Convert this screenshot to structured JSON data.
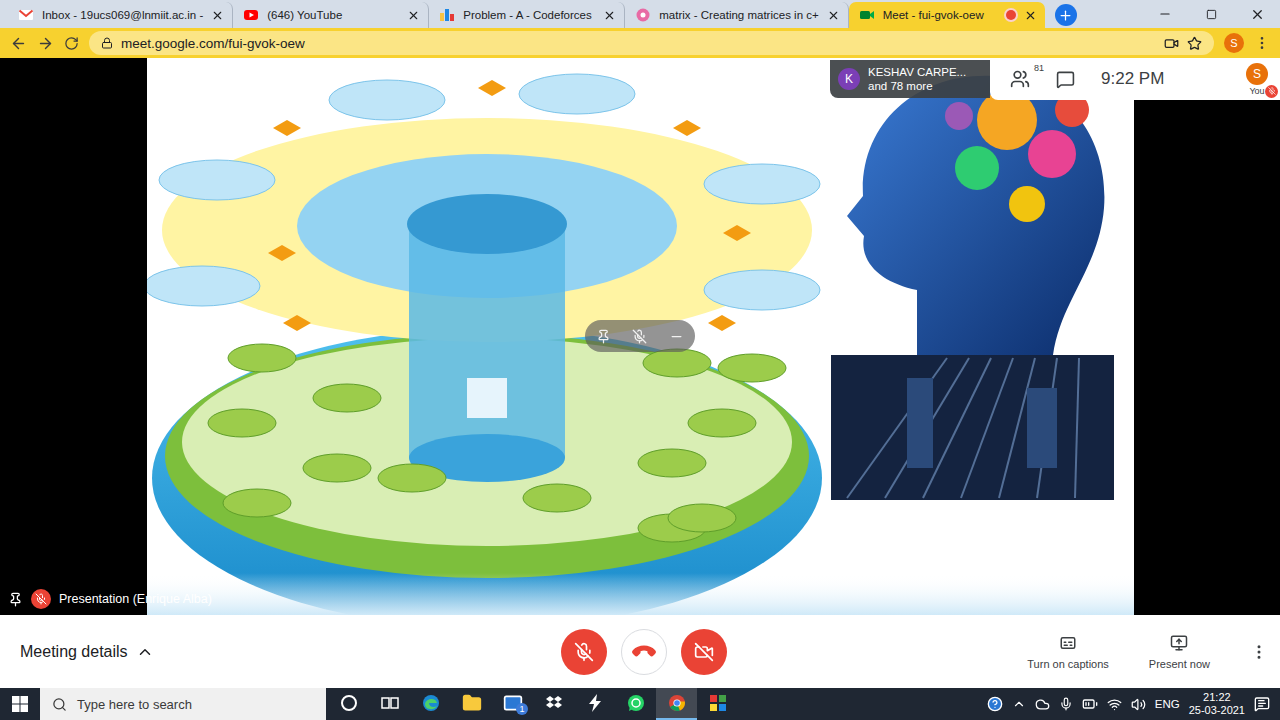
{
  "browser": {
    "tabs": [
      {
        "label": "Inbox - 19ucs069@lnmiit.ac.in -",
        "kind": "gmail",
        "selected": false,
        "recording": false
      },
      {
        "label": "(646) YouTube",
        "kind": "youtube",
        "selected": false,
        "recording": false
      },
      {
        "label": "Problem - A - Codeforces",
        "kind": "codeforces",
        "selected": false,
        "recording": false
      },
      {
        "label": "matrix - Creating matrices in c+",
        "kind": "page",
        "selected": false,
        "recording": false
      },
      {
        "label": "Meet - fui-gvok-oew",
        "kind": "meet",
        "selected": true,
        "recording": true
      }
    ],
    "url": "meet.google.com/fui-gvok-oew",
    "profile": "S"
  },
  "meeting": {
    "participants": {
      "avatar": "K",
      "name": "KESHAV CARPE...",
      "more": "and 78 more"
    },
    "people_count": "81",
    "time": "9:22 PM",
    "self": {
      "avatar": "S",
      "label": "You",
      "muted": true
    },
    "presenter": {
      "label": "Presentation (Enrique Alba)",
      "muted": true
    },
    "controls": {
      "mic_muted": true,
      "camera_off": true
    },
    "meeting_details": "Meeting details",
    "captions": "Turn on captions",
    "present": "Present now"
  },
  "taskbar": {
    "search_placeholder": "Type here to search",
    "apps": [
      {
        "kind": "cortana",
        "selected": false,
        "badge": ""
      },
      {
        "kind": "taskview",
        "selected": false,
        "badge": ""
      },
      {
        "kind": "edge",
        "selected": false,
        "badge": ""
      },
      {
        "kind": "explorer",
        "selected": false,
        "badge": ""
      },
      {
        "kind": "mail",
        "selected": false,
        "badge": "1"
      },
      {
        "kind": "dropbox",
        "selected": false,
        "badge": ""
      },
      {
        "kind": "lightning",
        "selected": false,
        "badge": ""
      },
      {
        "kind": "whatsapp",
        "selected": false,
        "badge": ""
      },
      {
        "kind": "chrome",
        "selected": true,
        "badge": ""
      },
      {
        "kind": "app",
        "selected": false,
        "badge": ""
      }
    ],
    "language": "ENG",
    "time": "21:22",
    "date": "25-03-2021"
  }
}
